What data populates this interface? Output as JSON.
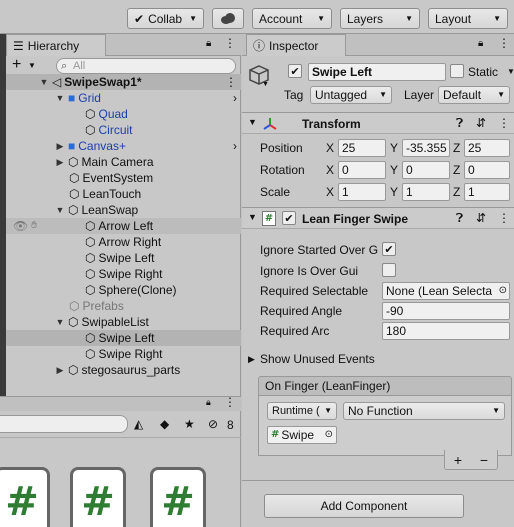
{
  "toolbar": {
    "collab": "Collab",
    "account": "Account",
    "layers": "Layers",
    "layout": "Layout"
  },
  "hierarchy": {
    "tab": "Hierarchy",
    "add": "+",
    "search_placeholder": "All",
    "scene": "SwipeSwap1*",
    "items": [
      {
        "label": "Grid"
      },
      {
        "label": "Quad"
      },
      {
        "label": "Circuit"
      },
      {
        "label": "Canvas+"
      },
      {
        "label": "Main Camera"
      },
      {
        "label": "EventSystem"
      },
      {
        "label": "LeanTouch"
      },
      {
        "label": "LeanSwap"
      },
      {
        "label": "Arrow Left"
      },
      {
        "label": "Arrow Right"
      },
      {
        "label": "Swipe Left"
      },
      {
        "label": "Swipe Right"
      },
      {
        "label": "Sphere(Clone)"
      },
      {
        "label": "Prefabs"
      },
      {
        "label": "SwipableList"
      },
      {
        "label": "Swipe Left"
      },
      {
        "label": "Swipe Right"
      },
      {
        "label": "stegosaurus_parts"
      }
    ]
  },
  "project": {
    "badge_count": "8",
    "icons": [
      "#",
      "#",
      "#"
    ]
  },
  "inspector": {
    "tab": "Inspector",
    "object_name": "Swipe Left",
    "static_label": "Static",
    "tag_label": "Tag",
    "tag_value": "Untagged",
    "layer_label": "Layer",
    "layer_value": "Default",
    "transform": {
      "title": "Transform",
      "position_label": "Position",
      "rotation_label": "Rotation",
      "scale_label": "Scale",
      "x": "X",
      "y": "Y",
      "z": "Z",
      "position": [
        "25",
        "-35.355",
        "25"
      ],
      "rotation": [
        "0",
        "0",
        "0"
      ],
      "scale": [
        "1",
        "1",
        "1"
      ]
    },
    "lean": {
      "title": "Lean Finger Swipe",
      "ignore_started": "Ignore Started Over G",
      "ignore_over_gui": "Ignore Is Over Gui",
      "required_selectable": "Required Selectable",
      "required_selectable_value": "None (Lean Selecta",
      "required_angle": "Required Angle",
      "required_angle_value": "-90",
      "required_arc": "Required Arc",
      "required_arc_value": "180",
      "show_unused": "Show Unused Events",
      "on_finger": "On Finger (LeanFinger)",
      "runtime": "Runtime (",
      "no_function": "No Function",
      "object_ref": "Swipe",
      "plus": "+",
      "minus": "−"
    },
    "add_component": "Add Component"
  }
}
